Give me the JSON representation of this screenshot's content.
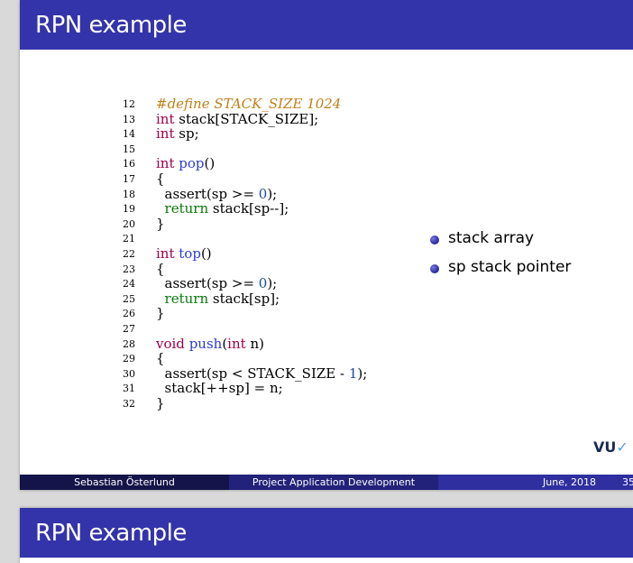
{
  "slides": [
    {
      "title": "RPN example",
      "code_lines": [
        {
          "n": "12",
          "parts": [
            {
              "c": "pp",
              "t": "#define STACK_SIZE 1024"
            }
          ]
        },
        {
          "n": "13",
          "parts": [
            {
              "c": "kw",
              "t": "int"
            },
            {
              "c": "",
              "t": " stack[STACK_SIZE];"
            }
          ]
        },
        {
          "n": "14",
          "parts": [
            {
              "c": "kw",
              "t": "int"
            },
            {
              "c": "",
              "t": " sp;"
            }
          ]
        },
        {
          "n": "15",
          "parts": []
        },
        {
          "n": "16",
          "parts": [
            {
              "c": "kw",
              "t": "int"
            },
            {
              "c": "",
              "t": " "
            },
            {
              "c": "fn",
              "t": "pop"
            },
            {
              "c": "",
              "t": "()"
            }
          ]
        },
        {
          "n": "17",
          "parts": [
            {
              "c": "",
              "t": "{"
            }
          ]
        },
        {
          "n": "18",
          "parts": [
            {
              "c": "",
              "t": "  assert(sp >= "
            },
            {
              "c": "num",
              "t": "0"
            },
            {
              "c": "",
              "t": ");"
            }
          ]
        },
        {
          "n": "19",
          "parts": [
            {
              "c": "",
              "t": "  "
            },
            {
              "c": "ret",
              "t": "return"
            },
            {
              "c": "",
              "t": " stack[sp--];"
            }
          ]
        },
        {
          "n": "20",
          "parts": [
            {
              "c": "",
              "t": "}"
            }
          ]
        },
        {
          "n": "21",
          "parts": []
        },
        {
          "n": "22",
          "parts": [
            {
              "c": "kw",
              "t": "int"
            },
            {
              "c": "",
              "t": " "
            },
            {
              "c": "fn",
              "t": "top"
            },
            {
              "c": "",
              "t": "()"
            }
          ]
        },
        {
          "n": "23",
          "parts": [
            {
              "c": "",
              "t": "{"
            }
          ]
        },
        {
          "n": "24",
          "parts": [
            {
              "c": "",
              "t": "  assert(sp >= "
            },
            {
              "c": "num",
              "t": "0"
            },
            {
              "c": "",
              "t": ");"
            }
          ]
        },
        {
          "n": "25",
          "parts": [
            {
              "c": "",
              "t": "  "
            },
            {
              "c": "ret",
              "t": "return"
            },
            {
              "c": "",
              "t": " stack[sp];"
            }
          ]
        },
        {
          "n": "26",
          "parts": [
            {
              "c": "",
              "t": "}"
            }
          ]
        },
        {
          "n": "27",
          "parts": []
        },
        {
          "n": "28",
          "parts": [
            {
              "c": "kw",
              "t": "void"
            },
            {
              "c": "",
              "t": " "
            },
            {
              "c": "fn",
              "t": "push"
            },
            {
              "c": "",
              "t": "("
            },
            {
              "c": "kw",
              "t": "int"
            },
            {
              "c": "",
              "t": " n)"
            }
          ]
        },
        {
          "n": "29",
          "parts": [
            {
              "c": "",
              "t": "{"
            }
          ]
        },
        {
          "n": "30",
          "parts": [
            {
              "c": "",
              "t": "  assert(sp < STACK_SIZE - "
            },
            {
              "c": "num",
              "t": "1"
            },
            {
              "c": "",
              "t": ");"
            }
          ]
        },
        {
          "n": "31",
          "parts": [
            {
              "c": "",
              "t": "  stack[++sp] = n;"
            }
          ]
        },
        {
          "n": "32",
          "parts": [
            {
              "c": "",
              "t": "}"
            }
          ]
        }
      ],
      "bullets": [
        "stack array",
        "sp stack pointer"
      ],
      "logo_text": "VU",
      "footer": {
        "author": "Sebastian Österlund",
        "course": "Project Application Development",
        "date": "June, 2018",
        "page": "35"
      }
    },
    {
      "title": "RPN example"
    }
  ],
  "colors": {
    "title_bar": "#3434aa",
    "keyword": "#a0004a",
    "function": "#2a3cd6",
    "return": "#0a7a0a",
    "preprocessor": "#c0801a"
  },
  "icons": {
    "bullet": "ball-bullet-icon",
    "logo": "vu-logo-icon"
  }
}
